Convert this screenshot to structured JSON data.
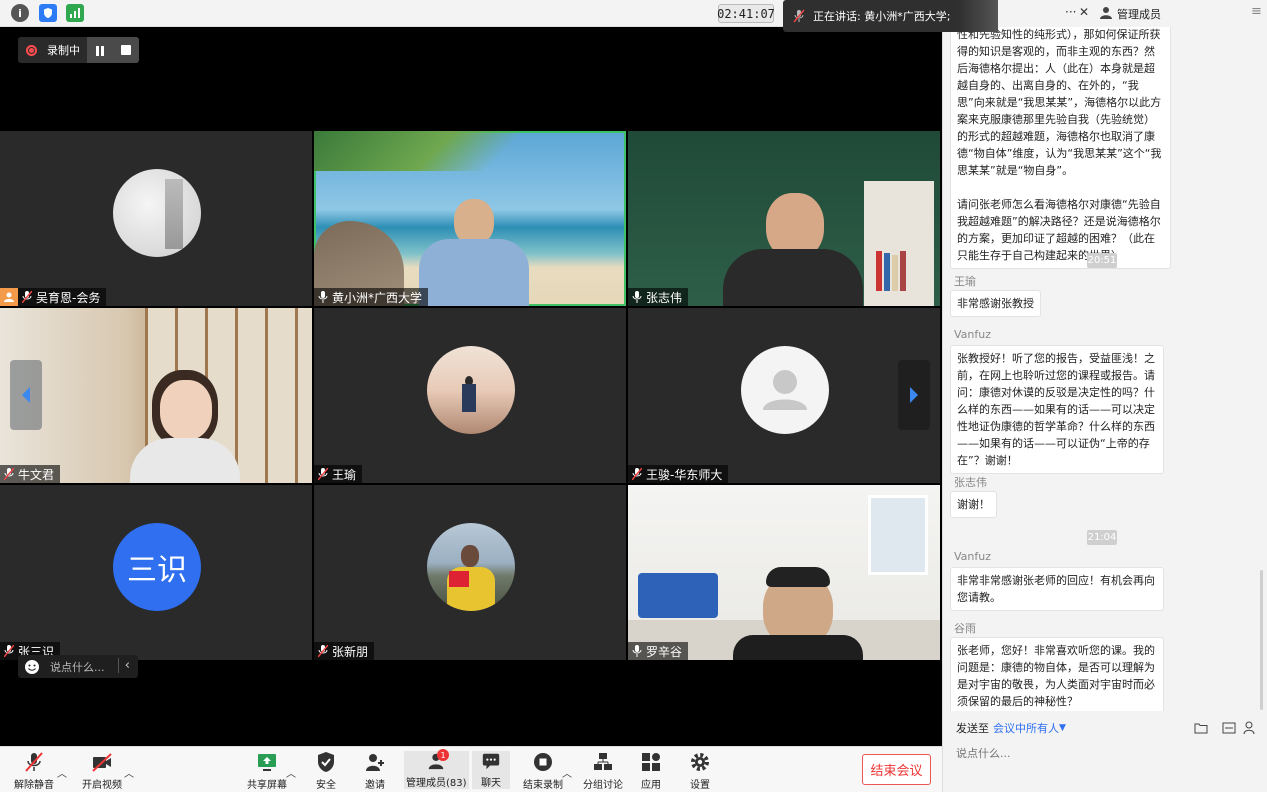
{
  "topbar": {
    "info_icon": "info-icon",
    "shield_icon": "shield-icon",
    "signal_icon": "signal-icon",
    "timer": "02:41:07",
    "speaking_label": "正在讲话: 黄小洲*广西大学;"
  },
  "recording": {
    "label": "录制中"
  },
  "tiles": [
    {
      "name": "吴育恩-会务",
      "muted": true,
      "host": true
    },
    {
      "name": "黄小洲*广西大学",
      "muted": false,
      "active": true
    },
    {
      "name": "张志伟",
      "muted": false
    },
    {
      "name": "牛文君",
      "muted": true
    },
    {
      "name": "王瑜",
      "muted": true
    },
    {
      "name": "王骏-华东师大",
      "muted": true
    },
    {
      "name": "张三识",
      "muted": true,
      "avatar_text": "三识"
    },
    {
      "name": "张新朋",
      "muted": true
    },
    {
      "name": "罗辛谷",
      "muted": false
    }
  ],
  "say_something": "说点什么...",
  "toolbar": {
    "unmute": "解除静音",
    "start_video": "开启视频",
    "share_screen": "共享屏幕",
    "security": "安全",
    "invite": "邀请",
    "manage_members": "管理成员(83)",
    "members_badge": "1",
    "chat": "聊天",
    "end_record": "结束录制",
    "breakout": "分组讨论",
    "apps": "应用",
    "settings": "设置",
    "end_meeting": "结束会议"
  },
  "panel": {
    "more": "···",
    "close": "✕",
    "manage_members": "管理成员",
    "menu_icon": "menu-icon",
    "messages": [
      {
        "sender": "",
        "text": "性和先验知性的纯形式），那如何保证所获得的知识是客观的，而非主观的东西？然后海德格尔提出：人（此在）本身就是超越自身的、出离自身的、在外的，“我思”向来就是“我思某某”，海德格尔以此方案来克服康德那里先验自我（先验统觉）的形式的超越难题，海德格尔也取消了康德“物自体”维度，认为“我思某某”这个“我思某某”就是“物自身”。\n\n请问张老师怎么看海德格尔对康德“先验自我超越难题”的解决路径？还是说海德格尔的方案，更加印证了超越的困难？（此在只能生存于自己构建起来的世界）"
      },
      {
        "time": "20:51"
      },
      {
        "sender": "王瑜",
        "text": "非常感谢张教授"
      },
      {
        "sender": "Vanfuz",
        "text": "张教授好！听了您的报告，受益匪浅！之前，在网上也聆听过您的课程或报告。请问：康德对休谟的反驳是决定性的吗？什么样的东西——如果有的话——可以决定性地证伪康德的哲学革命？什么样的东西——如果有的话——可以证伪“上帝的存在”？谢谢！"
      },
      {
        "sender": "张志伟",
        "text": "谢谢！"
      },
      {
        "time": "21:04"
      },
      {
        "sender": "Vanfuz",
        "text": "非常非常感谢张老师的回应！有机会再向您请教。"
      },
      {
        "sender": "谷雨",
        "text": "张老师，您好！非常喜欢听您的课。我的问题是：康德的物自体，是否可以理解为是对宇宙的敬畏，为人类面对宇宙时而必须保留的最后的神秘性？"
      }
    ],
    "send_to_label": "发送至",
    "send_to_value": "会议中所有人",
    "input_placeholder": "说点什么..."
  }
}
